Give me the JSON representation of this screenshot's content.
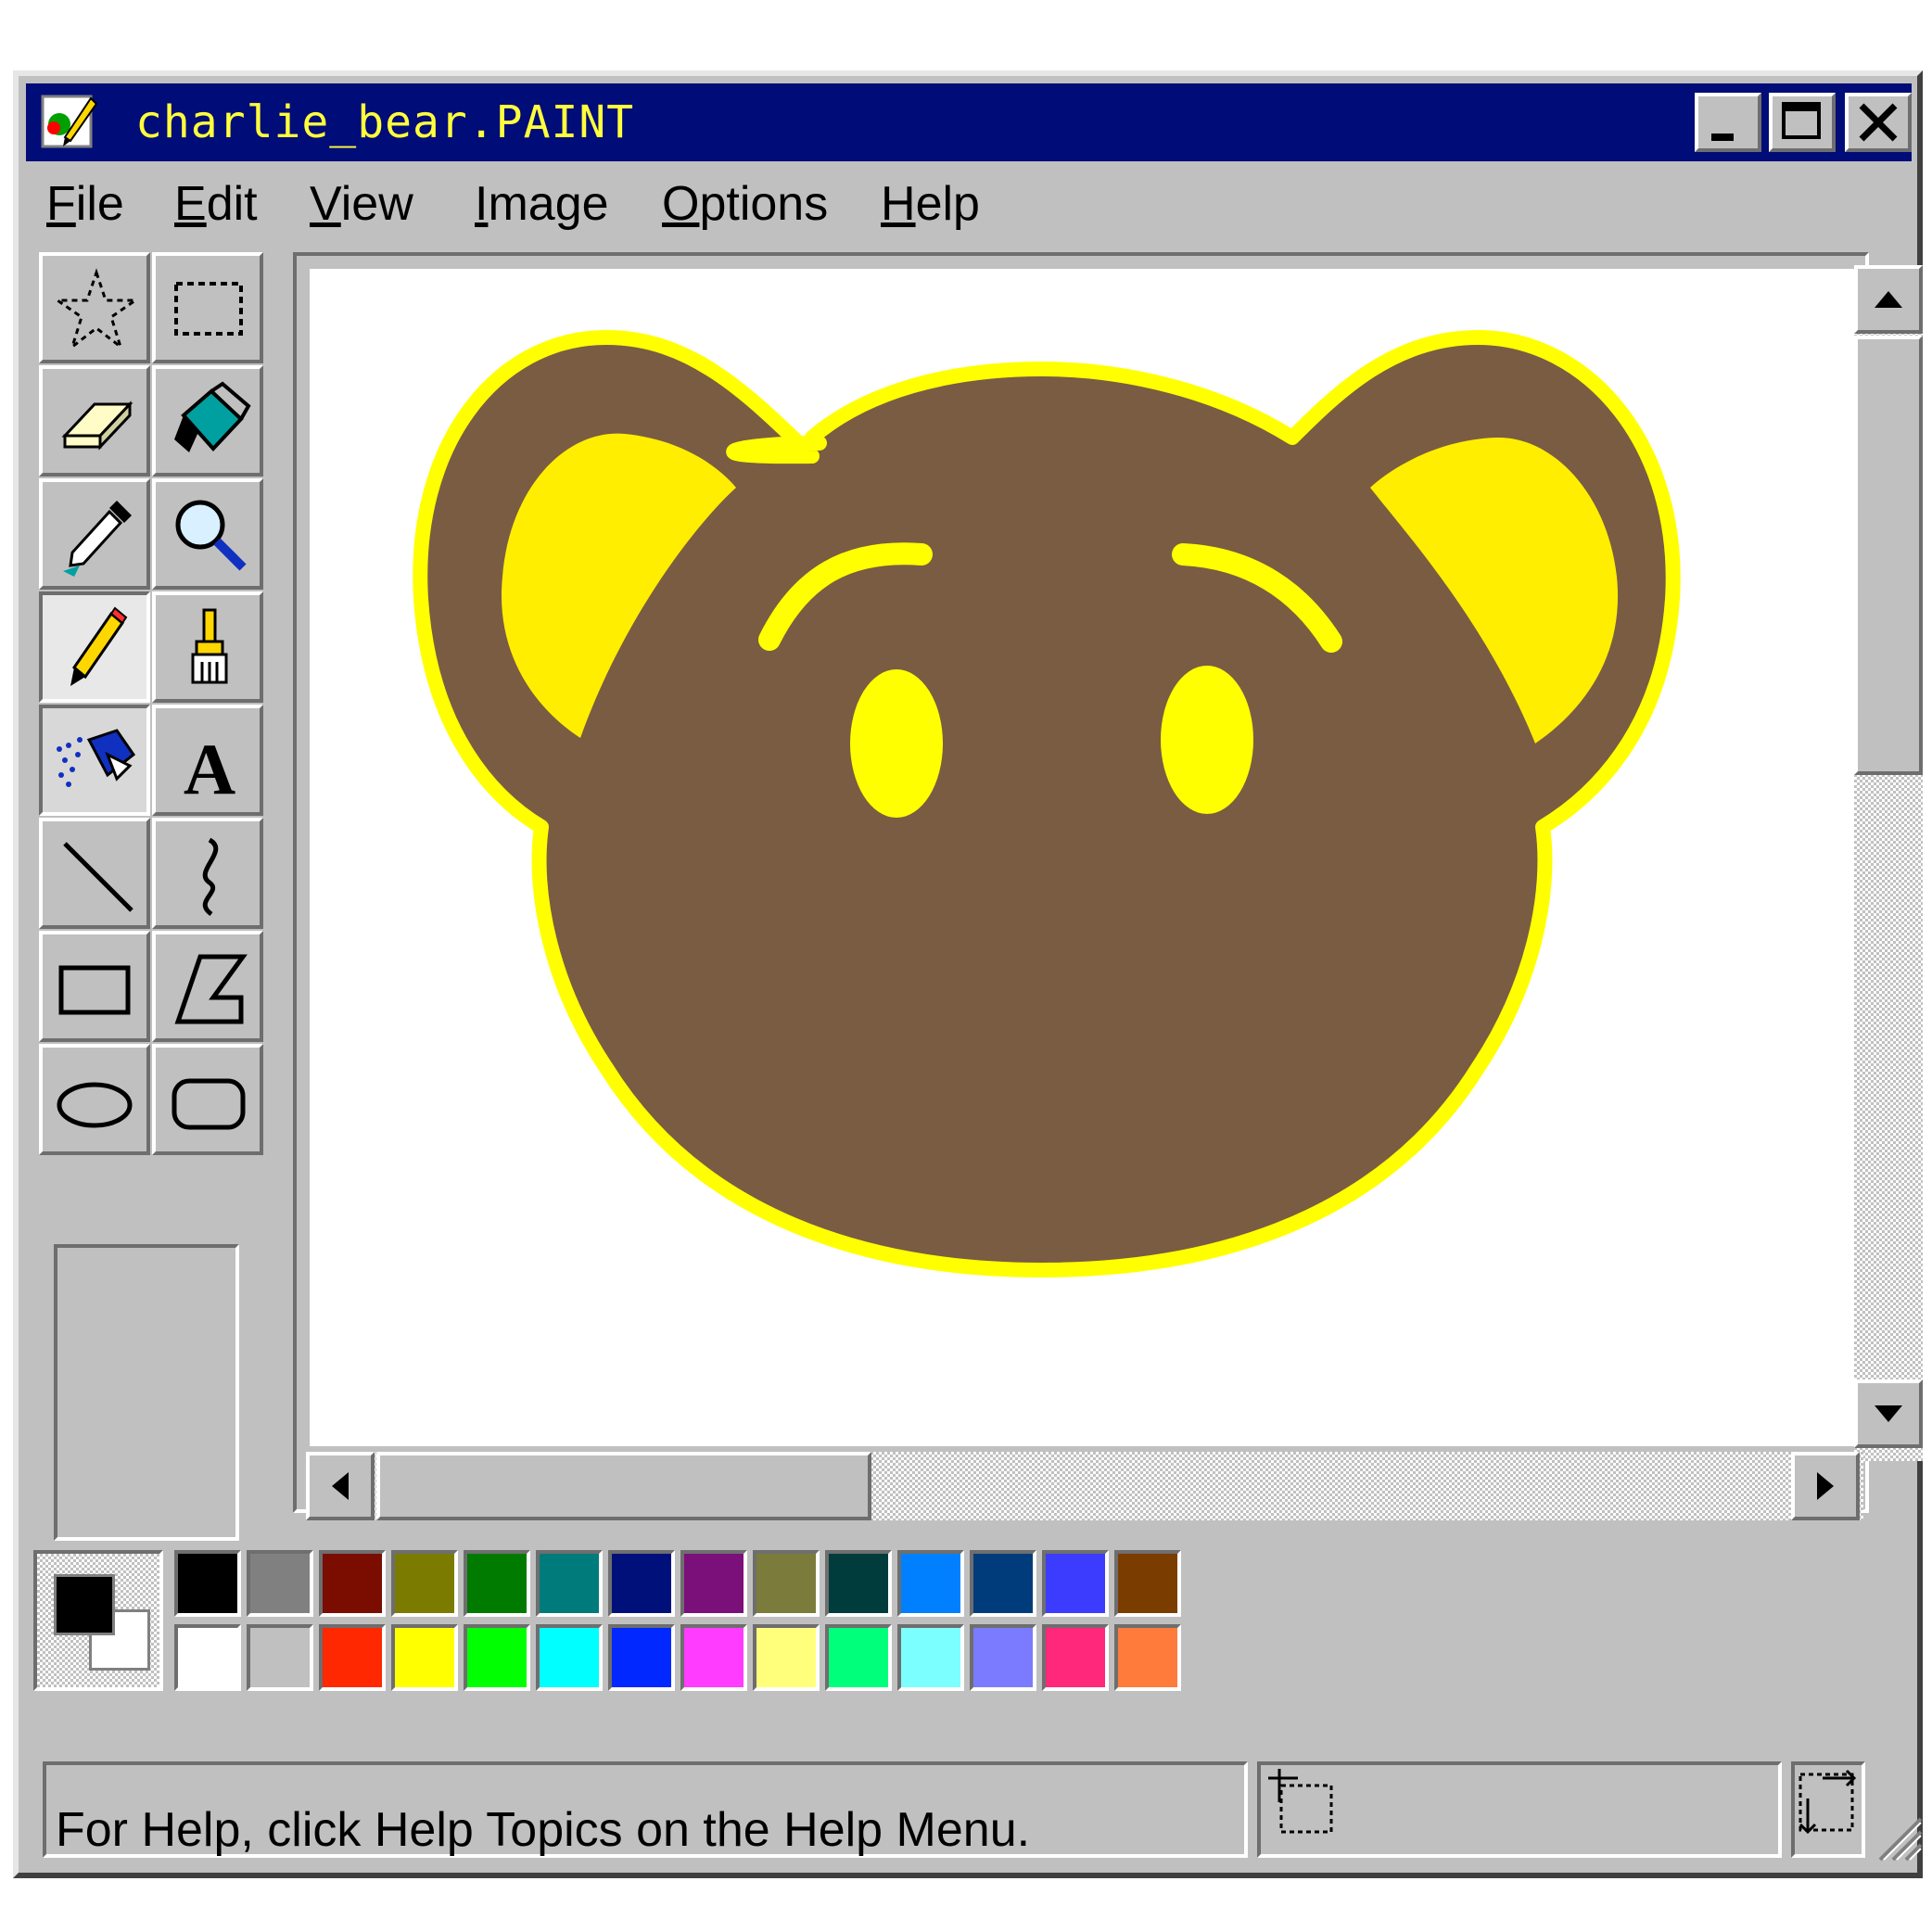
{
  "window": {
    "title": "charlie_bear.PAINT",
    "icon": "paint-app-icon",
    "controls": [
      "minimize-icon",
      "maximize-icon",
      "close-icon"
    ]
  },
  "menu": [
    {
      "label": "File",
      "accel": "F",
      "rest": "ile"
    },
    {
      "label": "Edit",
      "accel": "E",
      "rest": "dit"
    },
    {
      "label": "View",
      "accel": "V",
      "rest": "iew"
    },
    {
      "label": "Image",
      "accel": "I",
      "rest": "mage"
    },
    {
      "label": "Options",
      "accel": "O",
      "rest": "ptions"
    },
    {
      "label": "Help",
      "accel": "H",
      "rest": "elp"
    }
  ],
  "tools": [
    {
      "name": "free-form-select",
      "icon": "star-select-icon"
    },
    {
      "name": "select",
      "icon": "rect-select-icon"
    },
    {
      "name": "eraser",
      "icon": "eraser-icon"
    },
    {
      "name": "fill-with-color",
      "icon": "paint-bucket-icon"
    },
    {
      "name": "pick-color",
      "icon": "eyedropper-icon"
    },
    {
      "name": "magnifier",
      "icon": "magnifier-icon"
    },
    {
      "name": "pencil",
      "icon": "pencil-icon",
      "active": true
    },
    {
      "name": "brush",
      "icon": "brush-icon"
    },
    {
      "name": "airbrush",
      "icon": "airbrush-icon"
    },
    {
      "name": "text",
      "icon": "text-icon",
      "glyph": "A"
    },
    {
      "name": "line",
      "icon": "line-icon"
    },
    {
      "name": "curve",
      "icon": "curve-icon"
    },
    {
      "name": "rectangle",
      "icon": "rectangle-icon"
    },
    {
      "name": "polygon",
      "icon": "polygon-icon"
    },
    {
      "name": "ellipse",
      "icon": "ellipse-icon"
    },
    {
      "name": "rounded-rectangle",
      "icon": "rounded-rect-icon"
    }
  ],
  "colors": {
    "foreground": "#000000",
    "background": "#ffffff",
    "top_row": [
      "#000000",
      "#808080",
      "#7b0c00",
      "#7b7b00",
      "#007b00",
      "#007b7b",
      "#00107b",
      "#7b107b",
      "#7b7b3c",
      "#003c3c",
      "#0080ff",
      "#003c7b",
      "#3c3cff",
      "#7b3c00"
    ],
    "bottom_row": [
      "#ffffff",
      "#c0c0c0",
      "#ff2800",
      "#ffff00",
      "#00ff00",
      "#00ffff",
      "#0028ff",
      "#ff3cff",
      "#ffff7b",
      "#00ff7b",
      "#7bffff",
      "#7b7bff",
      "#ff287b",
      "#ff7b3c"
    ]
  },
  "drawing": {
    "subject": "bear face",
    "fill": "#7a5c43",
    "accent": "#ffff00"
  },
  "status": {
    "text": "For Help, click Help Topics on the Help Menu."
  }
}
